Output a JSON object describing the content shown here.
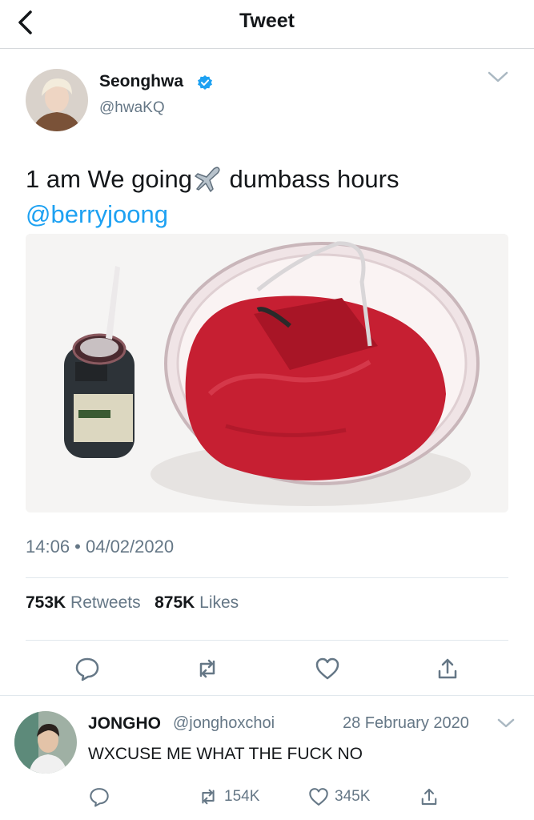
{
  "header": {
    "title": "Tweet"
  },
  "tweet": {
    "author_name": "Seonghwa",
    "author_handle": "@hwaKQ",
    "text_before": "1 am We going",
    "text_after": " dumbass hours",
    "mention": "@berryjoong",
    "timestamp": "14:06 • 04/02/2020",
    "retweet_count": "753K",
    "retweet_label": "Retweets",
    "like_count": "875K",
    "like_label": "Likes"
  },
  "reply": {
    "author_name": "JONGHO",
    "author_handle": "@jonghoxchoi",
    "date": "28 February 2020",
    "text": "WXCUSE ME WHAT THE FUCK NO",
    "retweet_count": "154K",
    "like_count": "345K"
  },
  "colors": {
    "accent": "#1da1f2",
    "muted": "#657786",
    "divider": "#e1e8ed"
  }
}
